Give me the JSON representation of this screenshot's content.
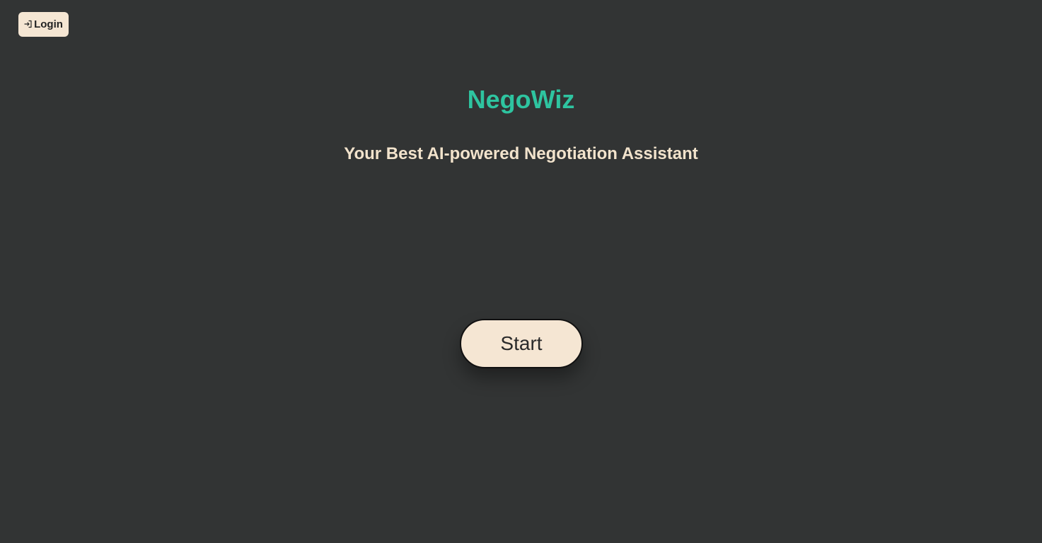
{
  "header": {
    "login_label": "Login",
    "login_icon": "login-icon"
  },
  "hero": {
    "title": "NegoWiz",
    "tagline": "Your Best AI-powered Negotiation Assistant"
  },
  "actions": {
    "start_label": "Start"
  },
  "colors": {
    "background": "#323434",
    "title": "#2ec4a0",
    "tagline": "#f2e3cc",
    "button_bg": "#f5e6d3",
    "button_text": "#2a2a2a"
  }
}
